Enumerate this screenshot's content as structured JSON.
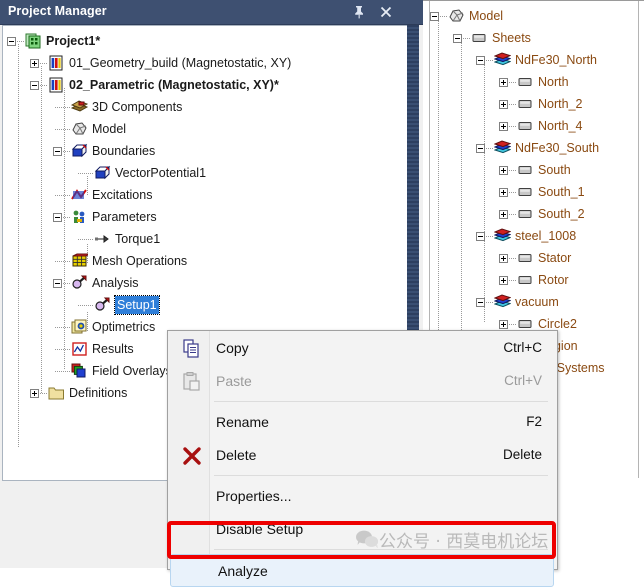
{
  "project_manager": {
    "title": "Project Manager",
    "pin_icon": "pin-icon",
    "close_icon": "close-icon",
    "tree": [
      {
        "label": "Project1*",
        "depth": 0,
        "expander": "minus",
        "icon": "project-icon",
        "bold": true,
        "selected": false
      },
      {
        "label": "01_Geometry_build (Magnetostatic, XY)",
        "depth": 1,
        "expander": "plus",
        "icon": "design-icon",
        "bold": false,
        "selected": false
      },
      {
        "label": "02_Parametric (Magnetostatic, XY)*",
        "depth": 1,
        "expander": "minus",
        "icon": "design-icon",
        "bold": true,
        "selected": false
      },
      {
        "label": "3D Components",
        "depth": 2,
        "expander": "none",
        "icon": "components-icon",
        "bold": false,
        "selected": false
      },
      {
        "label": "Model",
        "depth": 2,
        "expander": "none",
        "icon": "model-icon",
        "bold": false,
        "selected": false
      },
      {
        "label": "Boundaries",
        "depth": 2,
        "expander": "minus",
        "icon": "boundary-icon",
        "bold": false,
        "selected": false
      },
      {
        "label": "VectorPotential1",
        "depth": 3,
        "expander": "none",
        "icon": "boundary-icon",
        "bold": false,
        "selected": false
      },
      {
        "label": "Excitations",
        "depth": 2,
        "expander": "none",
        "icon": "excitation-icon",
        "bold": false,
        "selected": false
      },
      {
        "label": "Parameters",
        "depth": 2,
        "expander": "minus",
        "icon": "parameters-icon",
        "bold": false,
        "selected": false
      },
      {
        "label": "Torque1",
        "depth": 3,
        "expander": "none",
        "icon": "torque-icon",
        "bold": false,
        "selected": false
      },
      {
        "label": "Mesh Operations",
        "depth": 2,
        "expander": "none",
        "icon": "mesh-icon",
        "bold": false,
        "selected": false
      },
      {
        "label": "Analysis",
        "depth": 2,
        "expander": "minus",
        "icon": "analysis-icon",
        "bold": false,
        "selected": false
      },
      {
        "label": "Setup1",
        "depth": 3,
        "expander": "none",
        "icon": "analysis-icon",
        "bold": false,
        "selected": true
      },
      {
        "label": "Optimetrics",
        "depth": 2,
        "expander": "none",
        "icon": "optimetrics-icon",
        "bold": false,
        "selected": false
      },
      {
        "label": "Results",
        "depth": 2,
        "expander": "none",
        "icon": "results-icon",
        "bold": false,
        "selected": false
      },
      {
        "label": "Field Overlays",
        "depth": 2,
        "expander": "none",
        "icon": "field-overlays-icon",
        "bold": false,
        "selected": false
      },
      {
        "label": "Definitions",
        "depth": 1,
        "expander": "plus",
        "icon": "folder-icon",
        "bold": false,
        "selected": false
      }
    ]
  },
  "model_tree": {
    "items": [
      {
        "label": "Model",
        "depth": 0,
        "expander": "minus",
        "icon": "model-icon"
      },
      {
        "label": "Sheets",
        "depth": 1,
        "expander": "minus",
        "icon": "sheet-icon"
      },
      {
        "label": "NdFe30_North",
        "depth": 2,
        "expander": "minus",
        "icon": "material-icon"
      },
      {
        "label": "North",
        "depth": 3,
        "expander": "plus",
        "icon": "sheet-icon"
      },
      {
        "label": "North_2",
        "depth": 3,
        "expander": "plus",
        "icon": "sheet-icon"
      },
      {
        "label": "North_4",
        "depth": 3,
        "expander": "plus",
        "icon": "sheet-icon"
      },
      {
        "label": "NdFe30_South",
        "depth": 2,
        "expander": "minus",
        "icon": "material-icon"
      },
      {
        "label": "South",
        "depth": 3,
        "expander": "plus",
        "icon": "sheet-icon"
      },
      {
        "label": "South_1",
        "depth": 3,
        "expander": "plus",
        "icon": "sheet-icon"
      },
      {
        "label": "South_2",
        "depth": 3,
        "expander": "plus",
        "icon": "sheet-icon"
      },
      {
        "label": "steel_1008",
        "depth": 2,
        "expander": "minus",
        "icon": "material-icon"
      },
      {
        "label": "Stator",
        "depth": 3,
        "expander": "plus",
        "icon": "sheet-icon"
      },
      {
        "label": "Rotor",
        "depth": 3,
        "expander": "plus",
        "icon": "sheet-icon"
      },
      {
        "label": "vacuum",
        "depth": 2,
        "expander": "minus",
        "icon": "material-icon"
      },
      {
        "label": "Circle2",
        "depth": 3,
        "expander": "plus",
        "icon": "sheet-icon"
      },
      {
        "label": "Region",
        "depth": 3,
        "expander": "plus",
        "icon": "sheet-icon"
      },
      {
        "label": "Coordinate Systems",
        "depth": 1,
        "expander": "plus",
        "icon": "folder-icon"
      }
    ]
  },
  "context_menu": {
    "items": [
      {
        "label": "Copy",
        "accel": "Ctrl+C",
        "disabled": false,
        "highlighted": false,
        "icon": "copy-icon",
        "separator_after": false
      },
      {
        "label": "Paste",
        "accel": "Ctrl+V",
        "disabled": true,
        "highlighted": false,
        "icon": "paste-icon",
        "separator_after": true
      },
      {
        "label": "Rename",
        "accel": "F2",
        "disabled": false,
        "highlighted": false,
        "icon": "",
        "separator_after": false
      },
      {
        "label": "Delete",
        "accel": "Delete",
        "disabled": false,
        "highlighted": false,
        "icon": "delete-icon",
        "separator_after": true
      },
      {
        "label": "Properties...",
        "accel": "",
        "disabled": false,
        "highlighted": false,
        "icon": "",
        "separator_after": false
      },
      {
        "label": "Disable Setup",
        "accel": "",
        "disabled": false,
        "highlighted": false,
        "icon": "",
        "separator_after": true
      },
      {
        "label": "Analyze",
        "accel": "",
        "disabled": false,
        "highlighted": true,
        "icon": "",
        "separator_after": false
      }
    ]
  },
  "watermark": {
    "text": "公众号 · 西莫电机论坛",
    "icon": "wechat-icon"
  },
  "colors": {
    "titlebar": "#3e5071",
    "selection": "#2f7fd9",
    "highlight_box": "#ee0000",
    "model_text": "#8a4a12"
  }
}
